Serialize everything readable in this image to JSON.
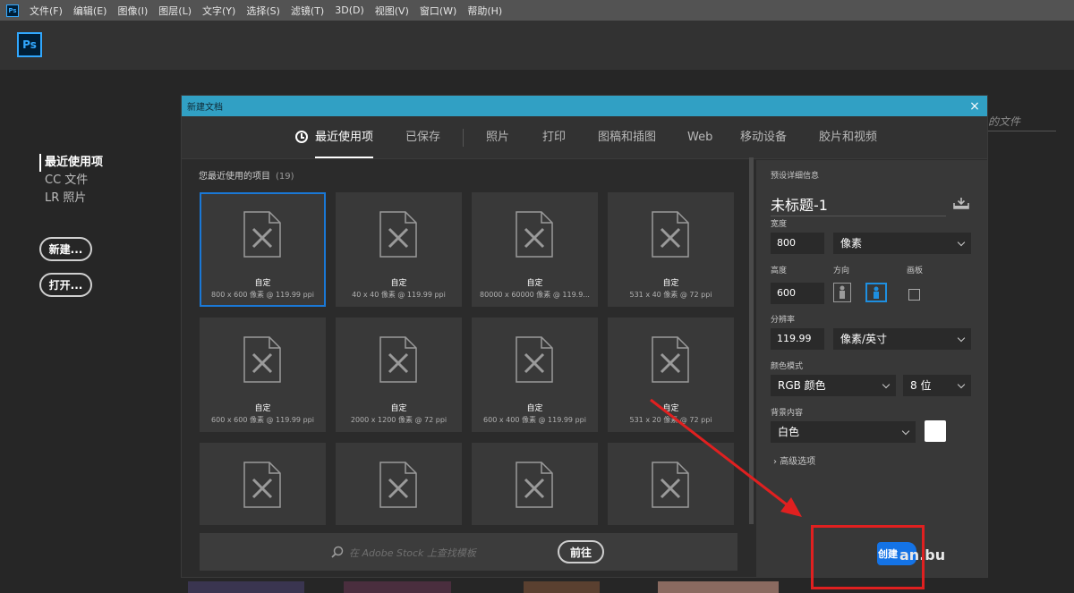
{
  "menubar": {
    "app_icon": "ps-app-icon",
    "items": [
      "文件(F)",
      "编辑(E)",
      "图像(I)",
      "图层(L)",
      "文字(Y)",
      "选择(S)",
      "滤镜(T)",
      "3D(D)",
      "视图(V)",
      "窗口(W)",
      "帮助(H)"
    ]
  },
  "home": {
    "logo": "Ps",
    "nav": [
      "最近使用项",
      "CC 文件",
      "LR 照片"
    ],
    "new_label": "新建...",
    "open_label": "打开...",
    "search_partial": "的文件"
  },
  "dialog": {
    "title": "新建文档",
    "close": "×",
    "tabs": [
      "最近使用项",
      "已保存",
      "照片",
      "打印",
      "图稿和插图",
      "Web",
      "移动设备",
      "胶片和视频"
    ],
    "recent_title": "您最近使用的项目",
    "recent_count": "(19)",
    "cards": [
      {
        "name": "自定",
        "size": "800 x 600 像素 @ 119.99 ppi"
      },
      {
        "name": "自定",
        "size": "40 x 40 像素 @ 119.99 ppi"
      },
      {
        "name": "自定",
        "size": "80000 x 60000 像素 @ 119.9..."
      },
      {
        "name": "自定",
        "size": "531 x 40 像素 @ 72 ppi"
      },
      {
        "name": "自定",
        "size": "600 x 600 像素 @ 119.99 ppi"
      },
      {
        "name": "自定",
        "size": "2000 x 1200 像素 @ 72 ppi"
      },
      {
        "name": "自定",
        "size": "600 x 400 像素 @ 119.99 ppi"
      },
      {
        "name": "自定",
        "size": "531 x 20 像素 @ 72 ppi"
      }
    ],
    "stock_placeholder": "在 Adobe Stock 上查找模板",
    "stock_go": "前往"
  },
  "preset": {
    "header": "预设详细信息",
    "doc_name": "未标题-1",
    "width_label": "宽度",
    "width_value": "800",
    "width_unit": "像素",
    "height_label": "高度",
    "height_value": "600",
    "orientation_label": "方向",
    "artboard_label": "画板",
    "resolution_label": "分辨率",
    "resolution_value": "119.99",
    "resolution_unit": "像素/英寸",
    "color_mode_label": "颜色模式",
    "color_mode": "RGB 颜色",
    "bit_depth": "8 位",
    "bg_label": "背景内容",
    "bg_value": "白色",
    "advanced": "高级选项"
  },
  "create": {
    "label": "创建",
    "watermark": "an.bu"
  },
  "colors": {
    "accent": "#1473e6",
    "titlebar": "#31a0c4",
    "annotation": "#e02020"
  }
}
